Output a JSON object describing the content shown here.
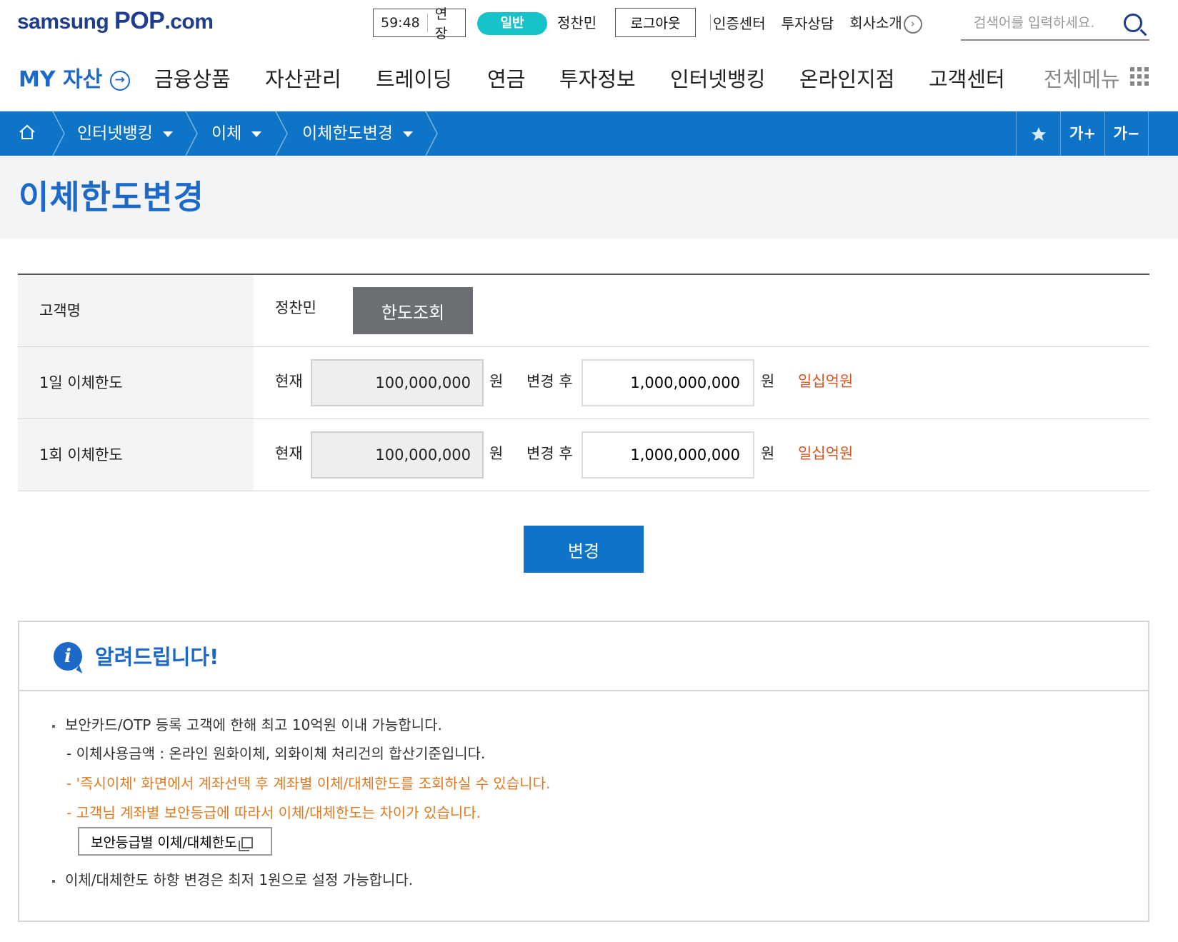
{
  "header": {
    "logo_prefix": "samsung ",
    "logo_pop": "POP",
    "logo_suffix": ".com",
    "session_timer": "59:48",
    "extend_label": "연장",
    "grade_badge": "일반",
    "user_name": "정찬민",
    "logout_label": "로그아웃",
    "links": [
      "인증센터",
      "투자상담",
      "회사소개"
    ],
    "search_placeholder": "검색어를 입력하세요."
  },
  "nav": {
    "my_label": "MY 자산",
    "items": [
      "금융상품",
      "자산관리",
      "트레이딩",
      "연금",
      "투자정보",
      "인터넷뱅킹",
      "온라인지점",
      "고객센터"
    ],
    "all_menu": "전체메뉴"
  },
  "breadcrumb": {
    "items": [
      "인터넷뱅킹",
      "이체",
      "이체한도변경"
    ],
    "font_up": "가+",
    "font_down": "가−"
  },
  "page": {
    "title": "이체한도변경"
  },
  "form": {
    "customer_label": "고객명",
    "customer_name": "정찬민",
    "query_button": "한도조회",
    "rows": [
      {
        "label": "1일 이체한도",
        "current_label": "현재",
        "current_value": "100,000,000",
        "unit": "원",
        "after_label": "변경 후",
        "new_value": "1,000,000,000",
        "korean_amount": "일십억원"
      },
      {
        "label": "1회 이체한도",
        "current_label": "현재",
        "current_value": "100,000,000",
        "unit": "원",
        "after_label": "변경 후",
        "new_value": "1,000,000,000",
        "korean_amount": "일십억원"
      }
    ],
    "change_button": "변경"
  },
  "notice": {
    "title": "알려드립니다!",
    "line1": "보안카드/OTP 등록 고객에 한해 최고 10억원 이내 가능합니다.",
    "line2": "- 이체사용금액 : 온라인 원화이체, 외화이체 처리건의 합산기준입니다.",
    "line3": "- '즉시이체' 화면에서 계좌선택 후 계좌별 이체/대체한도를 조회하실 수 있습니다.",
    "line4": "- 고객님 계좌별 보안등급에 따라서 이체/대체한도는 차이가 있습니다.",
    "popup_button": "보안등급별 이체/대체한도",
    "line5": "이체/대체한도 하향 변경은 최저 1원으로 설정 가능합니다."
  },
  "colors": {
    "brand_blue": "#0d74c8",
    "title_blue": "#1c69c9",
    "accent_teal": "#16c3c8",
    "highlight_orange": "#e07a22"
  }
}
